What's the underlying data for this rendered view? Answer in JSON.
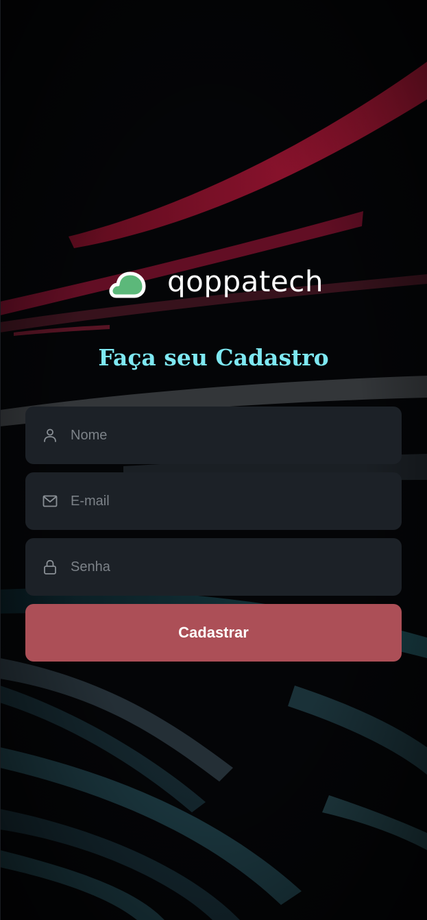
{
  "brand": {
    "logo_text": "qoppatech",
    "logo_icon": "cloud-icon",
    "logo_color": "#5cb87a"
  },
  "page": {
    "title": "Faça seu Cadastro"
  },
  "form": {
    "name": {
      "placeholder": "Nome",
      "value": "",
      "icon": "user-icon"
    },
    "email": {
      "placeholder": "E-mail",
      "value": "",
      "icon": "mail-icon"
    },
    "password": {
      "placeholder": "Senha",
      "value": "",
      "icon": "lock-icon"
    },
    "submit_label": "Cadastrar"
  },
  "colors": {
    "accent": "#ac4f57",
    "title": "#7ee8f2",
    "field_background": "#1c2127"
  }
}
